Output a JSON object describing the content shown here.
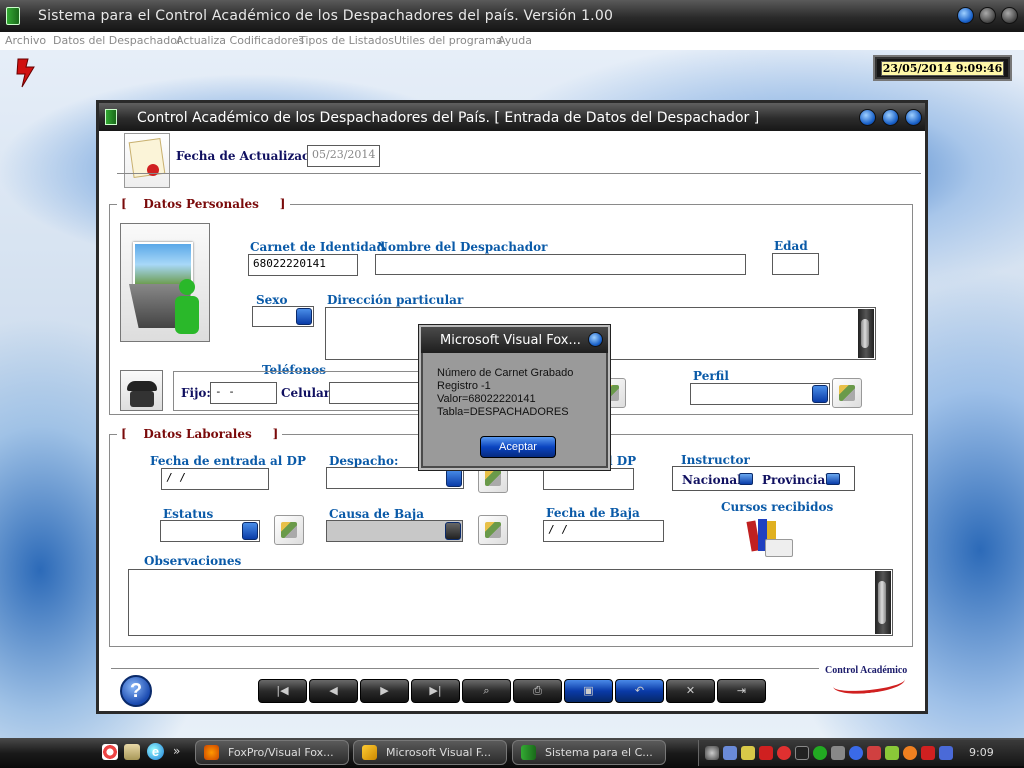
{
  "app": {
    "title": "Sistema  para el Control Académico de los Despachadores del país. Versión 1.00",
    "menu": [
      "Archivo",
      "Datos del Despachador",
      "Actualiza Codificadores",
      "Tipos de Listados",
      "Utiles del programa",
      "Ayuda"
    ],
    "clock": "23/05/2014 9:09:46"
  },
  "form": {
    "title": "Control Académico de los Despachadores del País.  [ Entrada de Datos del Despachador ]",
    "fecha_actualizacion_label": "Fecha de Actualización:",
    "fecha_actualizacion_value": "05/23/2014",
    "personal": {
      "section_title": "Datos Personales",
      "carnet_label": "Carnet de Identidad",
      "carnet_value": "68022220141",
      "nombre_label": "Nombre del Despachador",
      "nombre_value": "",
      "edad_label": "Edad",
      "edad_value": "",
      "sexo_label": "Sexo",
      "direccion_label": "Dirección particular",
      "telefonos_label": "Teléfonos",
      "fijo_label": "Fijo:",
      "fijo_value": "   -  -",
      "celular_label": "Celular:",
      "perfil_label": "Perfil"
    },
    "laboral": {
      "section_title": "Datos Laborales",
      "fecha_entrada_label": "Fecha de entrada al DP",
      "fecha_entrada_value": " / /",
      "despacho_label": "Despacho:",
      "fecha_dp_label_partial": "l DP",
      "instructor_label": "Instructor",
      "nacional_label": "Nacional:",
      "provincial_label": "Provincial:",
      "estatus_label": "Estatus",
      "causa_baja_label": "Causa de Baja",
      "fecha_baja_label": "Fecha de Baja",
      "fecha_baja_value": " / /",
      "cursos_label": "Cursos recibidos",
      "observaciones_label": "Observaciones"
    },
    "footer_logo": "Control Académico"
  },
  "dialog": {
    "title": "Microsoft Visual Fox...",
    "lines": [
      "Número de Carnet Grabado",
      "Registro -1",
      "Valor=68022220141",
      "Tabla=DESPACHADORES"
    ],
    "ok_label": "Aceptar"
  },
  "taskbar": {
    "quick_more": "»",
    "tasks": [
      "FoxPro/Visual Fox...",
      "Microsoft Visual F...",
      "Sistema  para el C..."
    ],
    "time": "9:09"
  }
}
